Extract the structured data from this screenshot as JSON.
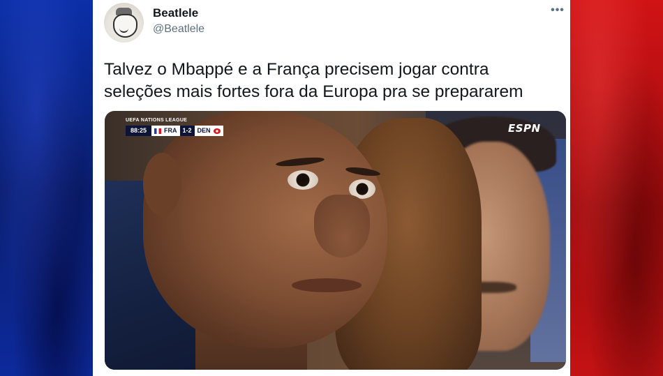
{
  "background": {
    "flag_colors": {
      "blue": "#0b2fa8",
      "white": "#ffffff",
      "red": "#d01315"
    }
  },
  "tweet": {
    "author": {
      "name": "Beatlele",
      "handle": "@Beatlele"
    },
    "more_icon": "more-dots-icon",
    "more_glyph": "•••",
    "text": "Talvez o Mbappé e a França precisem jogar contra seleções mais fortes fora da Europa pra se prepararem",
    "media": {
      "scorebug": {
        "league": "UEFA NATIONS LEAGUE",
        "time": "88:25",
        "home_team": "FRA",
        "score": "1-2",
        "away_team": "DEN"
      },
      "broadcaster": "ESPN"
    }
  }
}
